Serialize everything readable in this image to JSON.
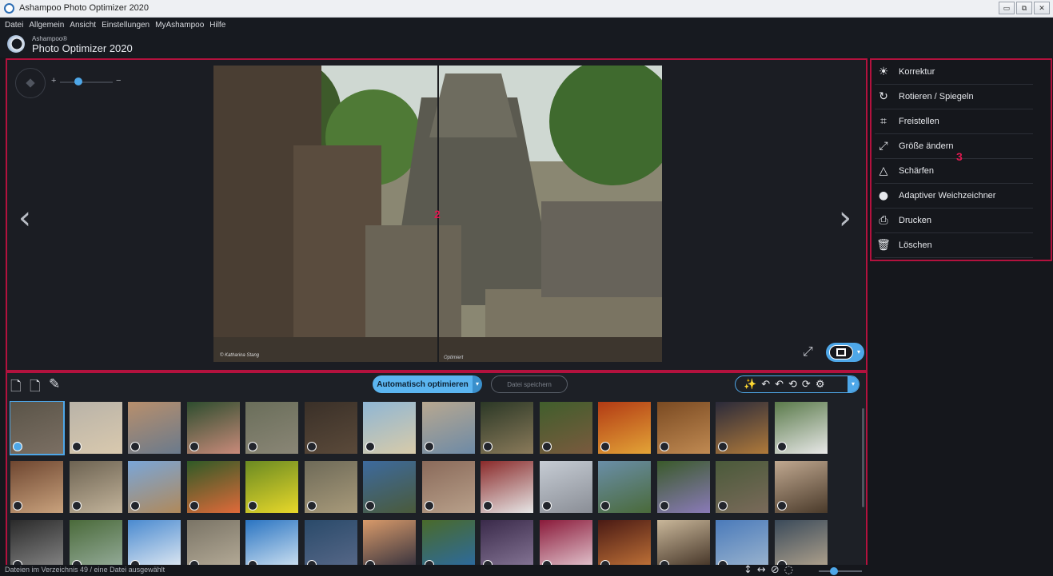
{
  "window": {
    "title": "Ashampoo Photo Optimizer 2020",
    "buttons": [
      "▭",
      "⧉",
      "✕"
    ]
  },
  "menu": [
    "Datei",
    "Allgemein",
    "Ansicht",
    "Einstellungen",
    "MyAshampoo",
    "Hilfe"
  ],
  "brand": {
    "company": "Ashampoo®",
    "product": "Photo Optimizer 2020"
  },
  "viewer": {
    "zoom_plus": "+",
    "zoom_minus": "−",
    "zoom_level": 0.35,
    "prev": "‹",
    "next": "›",
    "photo_credit": "© Katharina Stang",
    "compare_label": "Optimiert",
    "marker": "2"
  },
  "tools": {
    "marker": "3",
    "items": [
      {
        "label": "Korrektur",
        "icon": "sun-icon",
        "glyph": "☀"
      },
      {
        "label": "Rotieren / Spiegeln",
        "icon": "rotate-icon",
        "glyph": "↻"
      },
      {
        "label": "Freistellen",
        "icon": "crop-icon",
        "glyph": "⌗"
      },
      {
        "label": "Größe ändern",
        "icon": "resize-icon",
        "glyph": "⤢"
      },
      {
        "label": "Schärfen",
        "icon": "sharpen-icon",
        "glyph": "△"
      },
      {
        "label": "Adaptiver Weichzeichner",
        "icon": "drop-icon",
        "glyph": "●"
      },
      {
        "label": "Drucken",
        "icon": "printer-icon",
        "glyph": "⎙"
      },
      {
        "label": "Löschen",
        "icon": "trash-icon",
        "glyph": "🗑"
      }
    ]
  },
  "browser": {
    "auto_optimize": "Automatisch optimieren",
    "save_file": "Datei speichern",
    "toolbar_glyphs": [
      "🗋",
      "🗋",
      "✎"
    ],
    "action_glyphs": [
      "✨",
      "↶",
      "↶",
      "⟲",
      "⟳",
      "⚙"
    ],
    "caret": "▾"
  },
  "status": {
    "text": "Dateien im Verzeichnis 49 / eine Datei ausgewählt",
    "icons": [
      "↕",
      "↔",
      "⊘",
      "◌"
    ]
  },
  "thumbnails": [
    [
      "#5a5448",
      "#7b6f63"
    ],
    [
      "#b9b3a8",
      "#d9c9ae"
    ],
    [
      "#b88f6c",
      "#6a7a8c"
    ],
    [
      "#2d4d2e",
      "#c98a7a"
    ],
    [
      "#6a6e5a",
      "#8a8676"
    ],
    [
      "#3a3028",
      "#5b4a3a"
    ],
    [
      "#8fb6d4",
      "#d8cba9"
    ],
    [
      "#b8a890",
      "#6d8aa6"
    ],
    [
      "#2b3826",
      "#8a7a5a"
    ],
    [
      "#405e2c",
      "#7a5a3e"
    ],
    [
      "#b23a14",
      "#e3a437"
    ],
    [
      "#7a4a22",
      "#c08a52"
    ],
    [
      "#2a2a3a",
      "#b07a3a"
    ],
    [
      "#5a7a4a",
      "#e8e8e8"
    ],
    [
      "#6e4630",
      "#c9a27d"
    ],
    [
      "#6d6352",
      "#c2b39a"
    ],
    [
      "#7aa6d8",
      "#b0895a"
    ],
    [
      "#2f5a26",
      "#e06a3a"
    ],
    [
      "#6a8a22",
      "#e8d82a"
    ],
    [
      "#6e6a58",
      "#a89a7a"
    ],
    [
      "#3d6a9e",
      "#4a5a3a"
    ],
    [
      "#8a6a5a",
      "#b8a08a"
    ],
    [
      "#8a2a2a",
      "#e6e6e6"
    ],
    [
      "#c6ccd4",
      "#8a8e96"
    ],
    [
      "#6a8ea8",
      "#4a6a3a"
    ],
    [
      "#3a5a2a",
      "#8a7ab8"
    ],
    [
      "#4a5a3a",
      "#7a6a5a"
    ],
    [
      "#c0a890",
      "#4a3a2a"
    ],
    [
      "#2a2a2a",
      "#8a8a8a"
    ],
    [
      "#4a6a3a",
      "#9ab0a0"
    ],
    [
      "#4a8ad0",
      "#e8eef4"
    ],
    [
      "#7a7466",
      "#b8ae9a"
    ],
    [
      "#2a74c2",
      "#d8e8f4"
    ],
    [
      "#2a4a6a",
      "#5a6a8a"
    ],
    [
      "#d89a6a",
      "#2a2a3a"
    ],
    [
      "#4a6a2a",
      "#2a6aa8"
    ],
    [
      "#3a2a4a",
      "#8a7a9a"
    ],
    [
      "#8a1a3a",
      "#e8d0d8"
    ],
    [
      "#4a1a14",
      "#c8783a"
    ],
    [
      "#c9b79a",
      "#3a2a1e"
    ],
    [
      "#4a7aba",
      "#a0b8d0"
    ],
    [
      "#3a4a5a",
      "#b8a890"
    ]
  ]
}
